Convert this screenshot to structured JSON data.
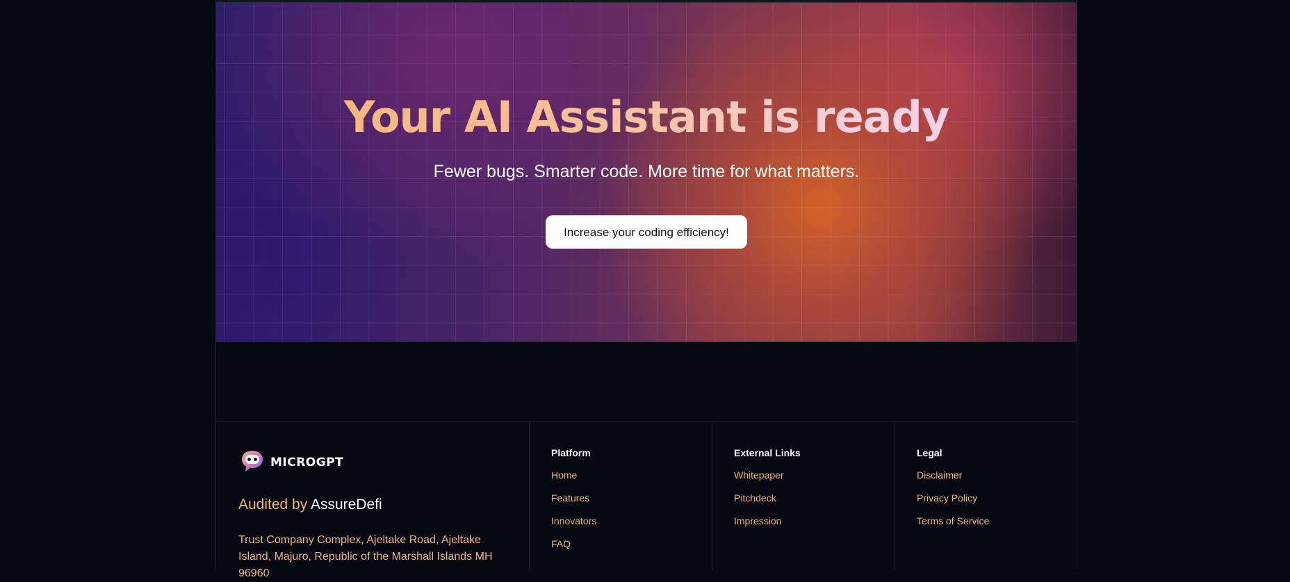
{
  "hero": {
    "title": "Your AI Assistant is ready",
    "subtitle": "Fewer bugs. Smarter code. More time for what matters.",
    "cta_label": "Increase your coding efficiency!"
  },
  "footer": {
    "brand": {
      "logo_text": "MICROGPT",
      "audited_prefix": "Audited by",
      "audited_name": "AssureDefi",
      "address": "Trust Company Complex, Ajeltake Road, Ajeltake Island, Majuro, Republic of the Marshall Islands MH 96960"
    },
    "columns": [
      {
        "title": "Platform",
        "links": [
          "Home",
          "Features",
          "Innovators",
          "FAQ"
        ]
      },
      {
        "title": "External Links",
        "links": [
          "Whitepaper",
          "Pitchdeck",
          "Impression"
        ]
      },
      {
        "title": "Legal",
        "links": [
          "Disclaimer",
          "Privacy Policy",
          "Terms of Service"
        ]
      }
    ]
  },
  "colors": {
    "background": "#070912",
    "accent": "#f2b57a",
    "cta_bg": "#ffffff"
  }
}
